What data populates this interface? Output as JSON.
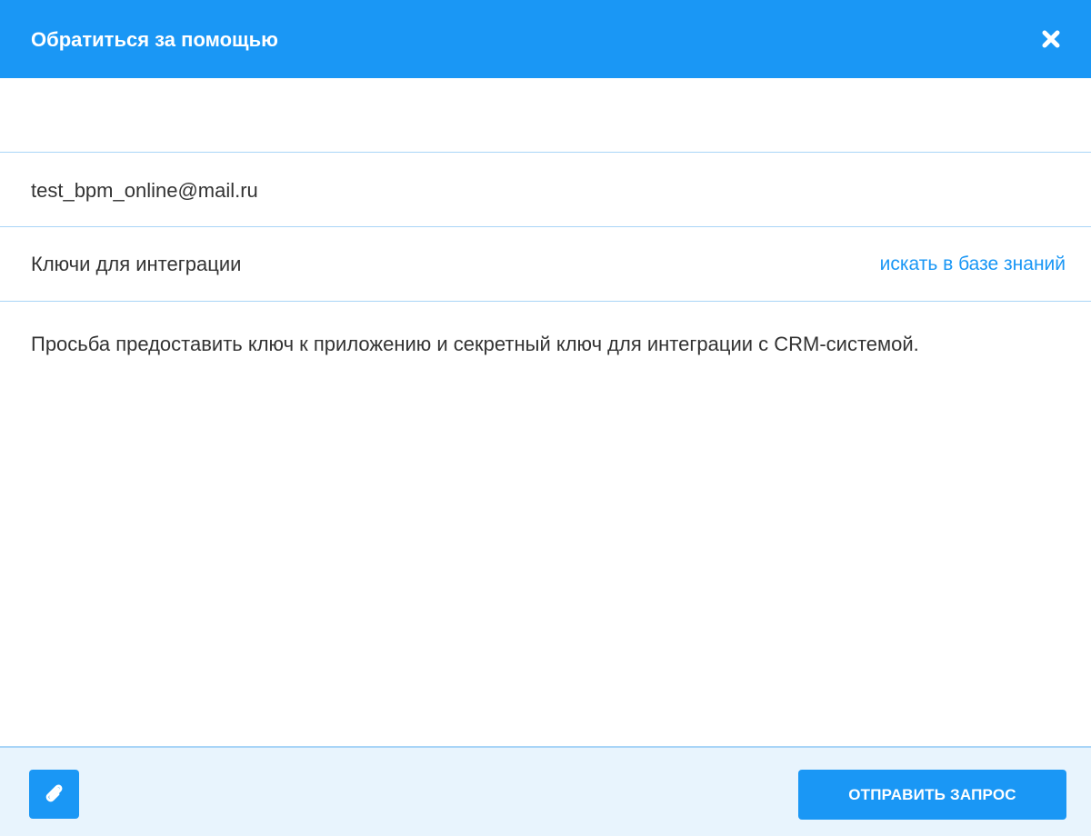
{
  "dialog": {
    "title": "Обратиться за помощью",
    "close_icon": "close-icon"
  },
  "form": {
    "subject_blank_value": "",
    "email_value": "test_bpm_online@mail.ru",
    "topic_value": "Ключи для интеграции",
    "knowledge_base_link": "искать в базе знаний",
    "message_value": "Просьба предоставить ключ к приложению и секретный ключ для интеграции с CRM-системой."
  },
  "footer": {
    "attach_icon": "paperclip-icon",
    "send_label": "ОТПРАВИТЬ ЗАПРОС"
  },
  "colors": {
    "accent": "#1a97f5",
    "footer_bg": "#e8f4fd",
    "divider": "#a9d5f7",
    "text": "#333333"
  }
}
